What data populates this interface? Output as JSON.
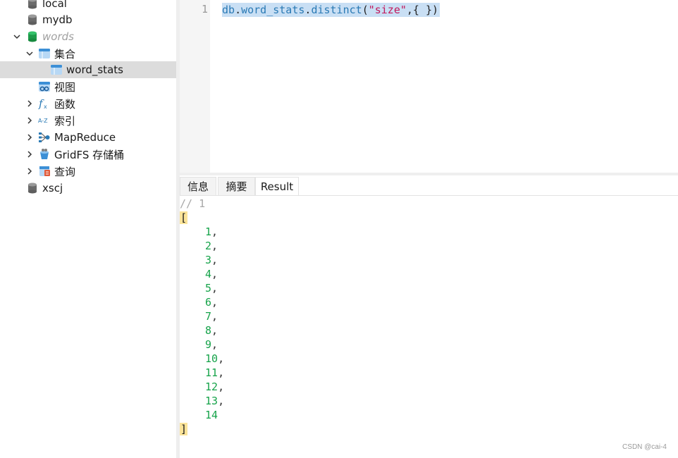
{
  "sidebar": {
    "items": [
      {
        "label": "local"
      },
      {
        "label": "mydb"
      },
      {
        "label": "words"
      },
      {
        "label": "集合"
      },
      {
        "label": "word_stats"
      },
      {
        "label": "视图"
      },
      {
        "label": "函数"
      },
      {
        "label": "索引"
      },
      {
        "label": "MapReduce"
      },
      {
        "label": "GridFS 存储桶"
      },
      {
        "label": "查询"
      },
      {
        "label": "xscj"
      }
    ],
    "icons": {
      "database": "database-icon",
      "collection": "collection-icon",
      "view": "view-icon",
      "function": "function-icon",
      "index": "index-icon",
      "mapreduce": "mapreduce-icon",
      "gridfs": "gridfs-bucket-icon",
      "query": "query-icon"
    }
  },
  "editor": {
    "line_number": "1",
    "tokens": {
      "db": "db",
      "dot1": ".",
      "collection": "word_stats",
      "dot2": ".",
      "method": "distinct",
      "open_paren": "(",
      "arg": "\"size\"",
      "rest": ",{ })"
    }
  },
  "tabs": [
    {
      "label": "信息"
    },
    {
      "label": "摘要"
    },
    {
      "label": "Result",
      "active": true
    }
  ],
  "result": {
    "comment": "// 1",
    "open": "[",
    "close": "]",
    "values": [
      "1",
      "2",
      "3",
      "4",
      "5",
      "6",
      "7",
      "8",
      "9",
      "10",
      "11",
      "12",
      "13",
      "14"
    ]
  },
  "watermark": "CSDN @cai-4",
  "colors": {
    "selection": "#c9dff4",
    "number": "#16a34a",
    "string": "#c2185b",
    "identifier": "#2a7ab5",
    "bracket_highlight": "#fbe49a",
    "selected_row": "#dcdcdc"
  }
}
